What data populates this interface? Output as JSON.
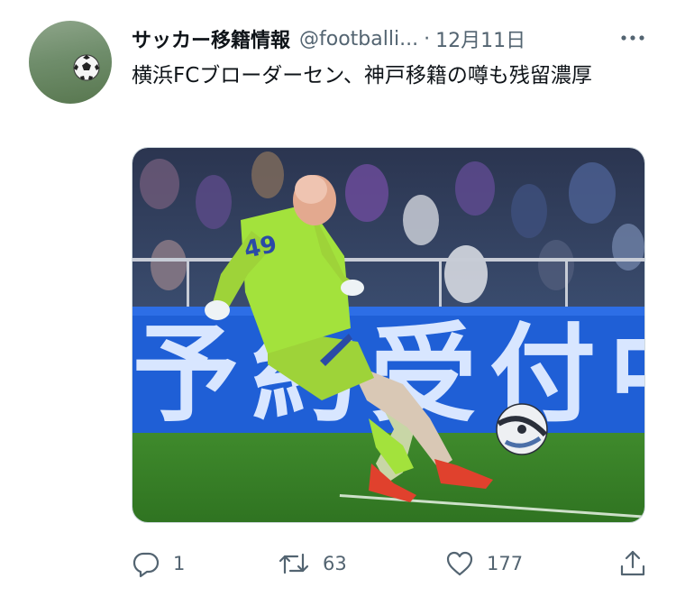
{
  "tweet": {
    "author_name": "サッカー移籍情報",
    "author_handle": "@footballi...",
    "separator": "·",
    "timestamp": "12月11日",
    "text": "横浜FCブローダーセン、神戸移籍の噂も残留濃厚",
    "media": {
      "banner_text": "予約受付中",
      "jersey_number": "49"
    }
  },
  "actions": {
    "reply_count": "1",
    "retweet_count": "63",
    "like_count": "177"
  },
  "icons": {
    "more": "more-horizontal-icon",
    "reply": "reply-icon",
    "retweet": "retweet-icon",
    "like": "heart-icon",
    "share": "share-icon"
  },
  "colors": {
    "secondary_text": "#536471",
    "primary_text": "#0f1419",
    "kit_green": "#a3e23c",
    "banner_blue": "#1f5fd6",
    "pitch_green": "#3f8a2c"
  }
}
